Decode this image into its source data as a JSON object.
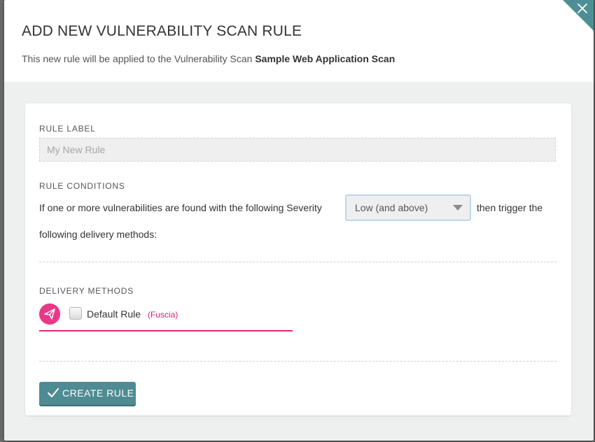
{
  "modal": {
    "title": "ADD NEW VULNERABILITY SCAN RULE",
    "subtitle_prefix": "This new rule will be applied to the Vulnerability Scan ",
    "scan_name": "Sample Web Application Scan"
  },
  "form": {
    "rule_label": {
      "label": "RULE LABEL",
      "placeholder": "My New Rule",
      "value": ""
    },
    "rule_conditions": {
      "label": "RULE CONDITIONS",
      "text_before": "If one or more vulnerabilities are found with the following Severity",
      "severity_selected": "Low (and above)",
      "text_after_1": "then trigger the",
      "text_after_2": "following delivery methods:"
    },
    "delivery_methods": {
      "label": "DELIVERY METHODS",
      "items": [
        {
          "name": "Default Rule",
          "tag": "(Fuscia)",
          "checked": false,
          "color": "#e2287e"
        }
      ]
    },
    "submit_label": "CREATE RULE"
  },
  "colors": {
    "accent_teal": "#4f8b93",
    "fuscia": "#e2287e"
  },
  "icons": [
    "close-icon",
    "chevron-down-icon",
    "send-icon",
    "check-icon"
  ]
}
